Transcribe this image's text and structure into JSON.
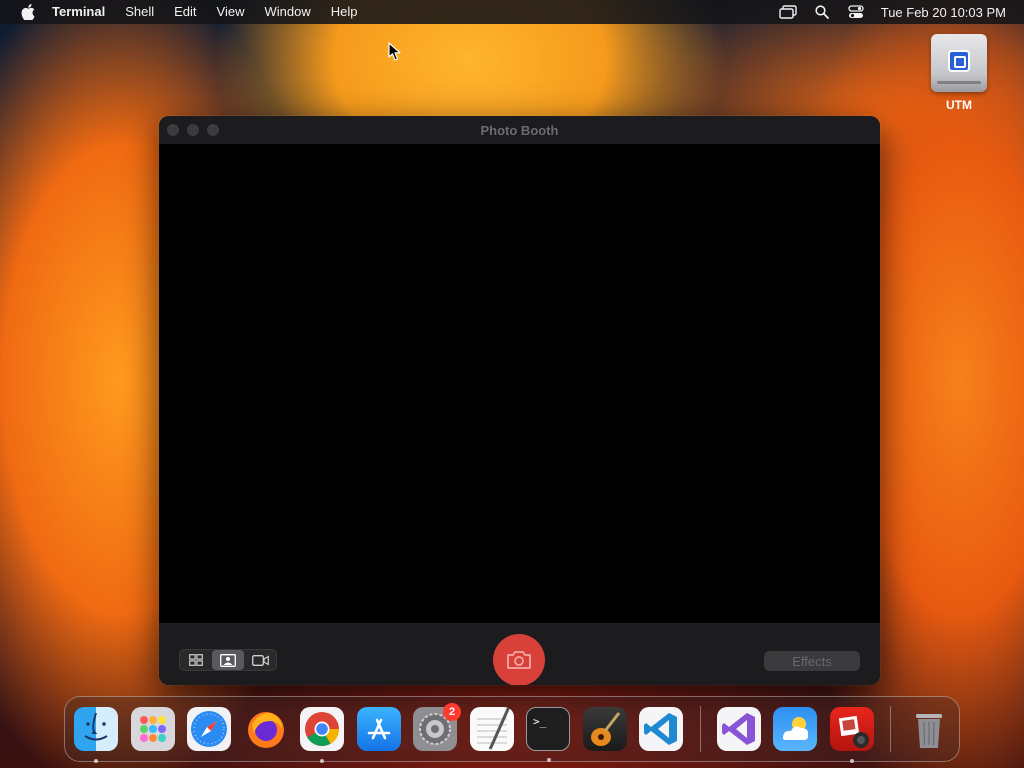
{
  "menubar": {
    "app_name": "Terminal",
    "menus": [
      "Shell",
      "Edit",
      "View",
      "Window",
      "Help"
    ],
    "clock": "Tue Feb 20  10:03 PM",
    "status_icons": [
      "screen-mirroring-icon",
      "spotlight-search-icon",
      "control-center-icon"
    ]
  },
  "desktop": {
    "icons": [
      {
        "label": "UTM",
        "icon": "external-drive-icon"
      }
    ]
  },
  "window": {
    "title": "Photo Booth",
    "modes": [
      "four-photos-mode-icon",
      "single-photo-mode-icon",
      "video-mode-icon"
    ],
    "selected_mode": "single-photo-mode-icon",
    "effects_label": "Effects",
    "colors": {
      "shutter": "#d8413a"
    }
  },
  "dock": {
    "apps": [
      {
        "name": "finder-icon",
        "running": true
      },
      {
        "name": "launchpad-icon",
        "running": false
      },
      {
        "name": "safari-icon",
        "running": false
      },
      {
        "name": "firefox-icon",
        "running": false
      },
      {
        "name": "chrome-icon",
        "running": true
      },
      {
        "name": "app-store-icon",
        "running": false
      },
      {
        "name": "system-settings-icon",
        "running": false,
        "badge": "2"
      },
      {
        "name": "textedit-icon",
        "running": false
      },
      {
        "name": "terminal-icon",
        "running": true
      },
      {
        "name": "garageband-icon",
        "running": false
      },
      {
        "name": "vscode-icon",
        "running": false
      }
    ],
    "recent_apps": [
      {
        "name": "visual-studio-icon",
        "running": false
      },
      {
        "name": "weather-icon",
        "running": false
      },
      {
        "name": "photo-booth-icon",
        "running": true
      }
    ],
    "trash": {
      "name": "trash-icon"
    }
  }
}
